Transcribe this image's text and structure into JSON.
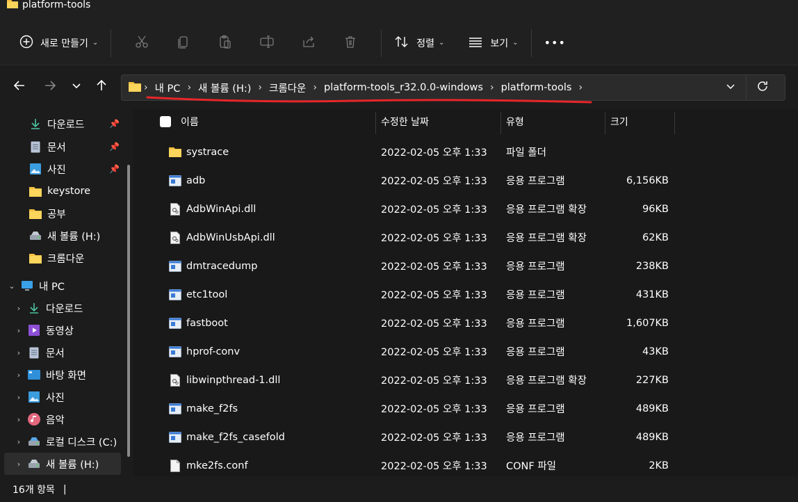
{
  "window": {
    "title": "platform-tools"
  },
  "toolbar": {
    "new_label": "새로 만들기",
    "sort_label": "정렬",
    "view_label": "보기",
    "icons": [
      "cut-icon",
      "copy-icon",
      "paste-icon",
      "rename-icon",
      "share-icon",
      "delete-icon"
    ],
    "more_label": "•••"
  },
  "address": {
    "crumbs": [
      "내 PC",
      "새 볼륨 (H:)",
      "크롬다운",
      "platform-tools_r32.0.0-windows",
      "platform-tools"
    ],
    "annotation_color": "#e8262a"
  },
  "sidebar": {
    "quick": [
      {
        "label": "다운로드",
        "icon": "download-icon",
        "pinned": true
      },
      {
        "label": "문서",
        "icon": "document-icon",
        "pinned": true
      },
      {
        "label": "사진",
        "icon": "pictures-icon",
        "pinned": true
      },
      {
        "label": "keystore",
        "icon": "folder-icon",
        "pinned": false
      },
      {
        "label": "공부",
        "icon": "folder-icon",
        "pinned": false
      },
      {
        "label": "새 볼륨 (H:)",
        "icon": "drive-icon",
        "pinned": false
      },
      {
        "label": "크롬다운",
        "icon": "folder-icon",
        "pinned": false
      }
    ],
    "this_pc": {
      "label": "내 PC",
      "icon": "computer-icon"
    },
    "pc_items": [
      {
        "label": "다운로드",
        "icon": "download-icon"
      },
      {
        "label": "동영상",
        "icon": "video-icon"
      },
      {
        "label": "문서",
        "icon": "document-icon"
      },
      {
        "label": "바탕 화면",
        "icon": "desktop-icon"
      },
      {
        "label": "사진",
        "icon": "pictures-icon"
      },
      {
        "label": "음악",
        "icon": "music-icon"
      },
      {
        "label": "로컬 디스크 (C:)",
        "icon": "drive-icon"
      },
      {
        "label": "새 볼륨 (H:)",
        "icon": "drive-icon"
      }
    ]
  },
  "columns": {
    "name": "이름",
    "date": "수정한 날짜",
    "type": "유형",
    "size": "크기"
  },
  "files": [
    {
      "name": "systrace",
      "date": "2022-02-05 오후 1:33",
      "type": "파일 폴더",
      "size": "",
      "icon": "folder-icon"
    },
    {
      "name": "adb",
      "date": "2022-02-05 오후 1:33",
      "type": "응용 프로그램",
      "size": "6,156KB",
      "icon": "exe-icon"
    },
    {
      "name": "AdbWinApi.dll",
      "date": "2022-02-05 오후 1:33",
      "type": "응용 프로그램 확장",
      "size": "96KB",
      "icon": "dll-icon"
    },
    {
      "name": "AdbWinUsbApi.dll",
      "date": "2022-02-05 오후 1:33",
      "type": "응용 프로그램 확장",
      "size": "62KB",
      "icon": "dll-icon"
    },
    {
      "name": "dmtracedump",
      "date": "2022-02-05 오후 1:33",
      "type": "응용 프로그램",
      "size": "238KB",
      "icon": "exe-icon"
    },
    {
      "name": "etc1tool",
      "date": "2022-02-05 오후 1:33",
      "type": "응용 프로그램",
      "size": "431KB",
      "icon": "exe-icon"
    },
    {
      "name": "fastboot",
      "date": "2022-02-05 오후 1:33",
      "type": "응용 프로그램",
      "size": "1,607KB",
      "icon": "exe-icon"
    },
    {
      "name": "hprof-conv",
      "date": "2022-02-05 오후 1:33",
      "type": "응용 프로그램",
      "size": "43KB",
      "icon": "exe-icon"
    },
    {
      "name": "libwinpthread-1.dll",
      "date": "2022-02-05 오후 1:33",
      "type": "응용 프로그램 확장",
      "size": "227KB",
      "icon": "dll-icon"
    },
    {
      "name": "make_f2fs",
      "date": "2022-02-05 오후 1:33",
      "type": "응용 프로그램",
      "size": "489KB",
      "icon": "exe-icon"
    },
    {
      "name": "make_f2fs_casefold",
      "date": "2022-02-05 오후 1:33",
      "type": "응용 프로그램",
      "size": "489KB",
      "icon": "exe-icon"
    },
    {
      "name": "mke2fs.conf",
      "date": "2022-02-05 오후 1:33",
      "type": "CONF 파일",
      "size": "2KB",
      "icon": "file-icon"
    }
  ],
  "status": {
    "count": "16개 항목",
    "divider": "|"
  }
}
